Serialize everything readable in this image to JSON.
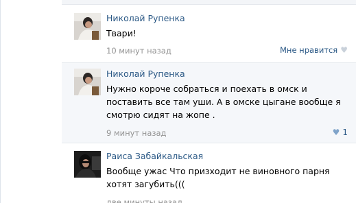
{
  "comments": [
    {
      "author": "Николай Рупенка",
      "lines": [
        "Твари!"
      ],
      "time": "10 минут назад",
      "like_label": "Мне нравится",
      "like_count": ""
    },
    {
      "author": "Николай Рупенка",
      "lines": [
        "Нужно короче собраться и поехать в омск и",
        "поставить все там уши. А в омске цыгане вообще я",
        "смотрю сидят на жопе ."
      ],
      "time": "9 минут назад",
      "like_label": "",
      "like_count": "1"
    },
    {
      "author": "Раиса Забайкальская",
      "lines": [
        "Вообще ужас Что призходит не виновного парня",
        "хотят загубить((("
      ],
      "time": "две минуты назад",
      "like_label": "",
      "like_count": ""
    }
  ],
  "icons": {
    "like": "heart-icon"
  },
  "colors": {
    "author_link": "#2a5885",
    "meta_text": "#939393",
    "alt_row_bg": "#f5f7fa"
  }
}
